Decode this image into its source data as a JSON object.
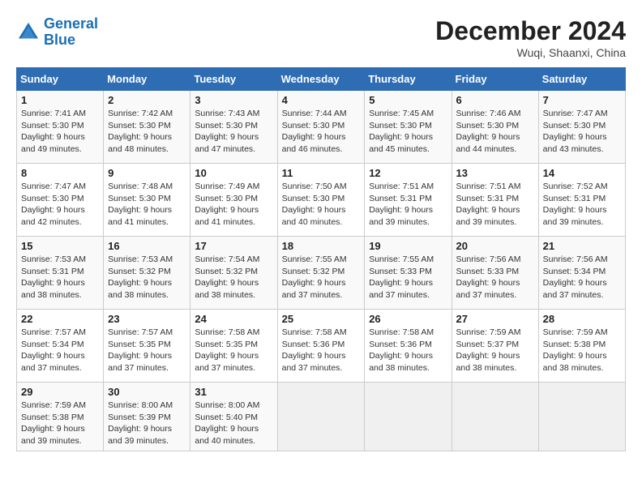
{
  "header": {
    "logo_line1": "General",
    "logo_line2": "Blue",
    "month_title": "December 2024",
    "location": "Wuqi, Shaanxi, China"
  },
  "days_of_week": [
    "Sunday",
    "Monday",
    "Tuesday",
    "Wednesday",
    "Thursday",
    "Friday",
    "Saturday"
  ],
  "weeks": [
    [
      {
        "day": "1",
        "sunrise": "Sunrise: 7:41 AM",
        "sunset": "Sunset: 5:30 PM",
        "daylight": "Daylight: 9 hours and 49 minutes."
      },
      {
        "day": "2",
        "sunrise": "Sunrise: 7:42 AM",
        "sunset": "Sunset: 5:30 PM",
        "daylight": "Daylight: 9 hours and 48 minutes."
      },
      {
        "day": "3",
        "sunrise": "Sunrise: 7:43 AM",
        "sunset": "Sunset: 5:30 PM",
        "daylight": "Daylight: 9 hours and 47 minutes."
      },
      {
        "day": "4",
        "sunrise": "Sunrise: 7:44 AM",
        "sunset": "Sunset: 5:30 PM",
        "daylight": "Daylight: 9 hours and 46 minutes."
      },
      {
        "day": "5",
        "sunrise": "Sunrise: 7:45 AM",
        "sunset": "Sunset: 5:30 PM",
        "daylight": "Daylight: 9 hours and 45 minutes."
      },
      {
        "day": "6",
        "sunrise": "Sunrise: 7:46 AM",
        "sunset": "Sunset: 5:30 PM",
        "daylight": "Daylight: 9 hours and 44 minutes."
      },
      {
        "day": "7",
        "sunrise": "Sunrise: 7:47 AM",
        "sunset": "Sunset: 5:30 PM",
        "daylight": "Daylight: 9 hours and 43 minutes."
      }
    ],
    [
      {
        "day": "8",
        "sunrise": "Sunrise: 7:47 AM",
        "sunset": "Sunset: 5:30 PM",
        "daylight": "Daylight: 9 hours and 42 minutes."
      },
      {
        "day": "9",
        "sunrise": "Sunrise: 7:48 AM",
        "sunset": "Sunset: 5:30 PM",
        "daylight": "Daylight: 9 hours and 41 minutes."
      },
      {
        "day": "10",
        "sunrise": "Sunrise: 7:49 AM",
        "sunset": "Sunset: 5:30 PM",
        "daylight": "Daylight: 9 hours and 41 minutes."
      },
      {
        "day": "11",
        "sunrise": "Sunrise: 7:50 AM",
        "sunset": "Sunset: 5:30 PM",
        "daylight": "Daylight: 9 hours and 40 minutes."
      },
      {
        "day": "12",
        "sunrise": "Sunrise: 7:51 AM",
        "sunset": "Sunset: 5:31 PM",
        "daylight": "Daylight: 9 hours and 39 minutes."
      },
      {
        "day": "13",
        "sunrise": "Sunrise: 7:51 AM",
        "sunset": "Sunset: 5:31 PM",
        "daylight": "Daylight: 9 hours and 39 minutes."
      },
      {
        "day": "14",
        "sunrise": "Sunrise: 7:52 AM",
        "sunset": "Sunset: 5:31 PM",
        "daylight": "Daylight: 9 hours and 39 minutes."
      }
    ],
    [
      {
        "day": "15",
        "sunrise": "Sunrise: 7:53 AM",
        "sunset": "Sunset: 5:31 PM",
        "daylight": "Daylight: 9 hours and 38 minutes."
      },
      {
        "day": "16",
        "sunrise": "Sunrise: 7:53 AM",
        "sunset": "Sunset: 5:32 PM",
        "daylight": "Daylight: 9 hours and 38 minutes."
      },
      {
        "day": "17",
        "sunrise": "Sunrise: 7:54 AM",
        "sunset": "Sunset: 5:32 PM",
        "daylight": "Daylight: 9 hours and 38 minutes."
      },
      {
        "day": "18",
        "sunrise": "Sunrise: 7:55 AM",
        "sunset": "Sunset: 5:32 PM",
        "daylight": "Daylight: 9 hours and 37 minutes."
      },
      {
        "day": "19",
        "sunrise": "Sunrise: 7:55 AM",
        "sunset": "Sunset: 5:33 PM",
        "daylight": "Daylight: 9 hours and 37 minutes."
      },
      {
        "day": "20",
        "sunrise": "Sunrise: 7:56 AM",
        "sunset": "Sunset: 5:33 PM",
        "daylight": "Daylight: 9 hours and 37 minutes."
      },
      {
        "day": "21",
        "sunrise": "Sunrise: 7:56 AM",
        "sunset": "Sunset: 5:34 PM",
        "daylight": "Daylight: 9 hours and 37 minutes."
      }
    ],
    [
      {
        "day": "22",
        "sunrise": "Sunrise: 7:57 AM",
        "sunset": "Sunset: 5:34 PM",
        "daylight": "Daylight: 9 hours and 37 minutes."
      },
      {
        "day": "23",
        "sunrise": "Sunrise: 7:57 AM",
        "sunset": "Sunset: 5:35 PM",
        "daylight": "Daylight: 9 hours and 37 minutes."
      },
      {
        "day": "24",
        "sunrise": "Sunrise: 7:58 AM",
        "sunset": "Sunset: 5:35 PM",
        "daylight": "Daylight: 9 hours and 37 minutes."
      },
      {
        "day": "25",
        "sunrise": "Sunrise: 7:58 AM",
        "sunset": "Sunset: 5:36 PM",
        "daylight": "Daylight: 9 hours and 37 minutes."
      },
      {
        "day": "26",
        "sunrise": "Sunrise: 7:58 AM",
        "sunset": "Sunset: 5:36 PM",
        "daylight": "Daylight: 9 hours and 38 minutes."
      },
      {
        "day": "27",
        "sunrise": "Sunrise: 7:59 AM",
        "sunset": "Sunset: 5:37 PM",
        "daylight": "Daylight: 9 hours and 38 minutes."
      },
      {
        "day": "28",
        "sunrise": "Sunrise: 7:59 AM",
        "sunset": "Sunset: 5:38 PM",
        "daylight": "Daylight: 9 hours and 38 minutes."
      }
    ],
    [
      {
        "day": "29",
        "sunrise": "Sunrise: 7:59 AM",
        "sunset": "Sunset: 5:38 PM",
        "daylight": "Daylight: 9 hours and 39 minutes."
      },
      {
        "day": "30",
        "sunrise": "Sunrise: 8:00 AM",
        "sunset": "Sunset: 5:39 PM",
        "daylight": "Daylight: 9 hours and 39 minutes."
      },
      {
        "day": "31",
        "sunrise": "Sunrise: 8:00 AM",
        "sunset": "Sunset: 5:40 PM",
        "daylight": "Daylight: 9 hours and 40 minutes."
      },
      null,
      null,
      null,
      null
    ]
  ]
}
